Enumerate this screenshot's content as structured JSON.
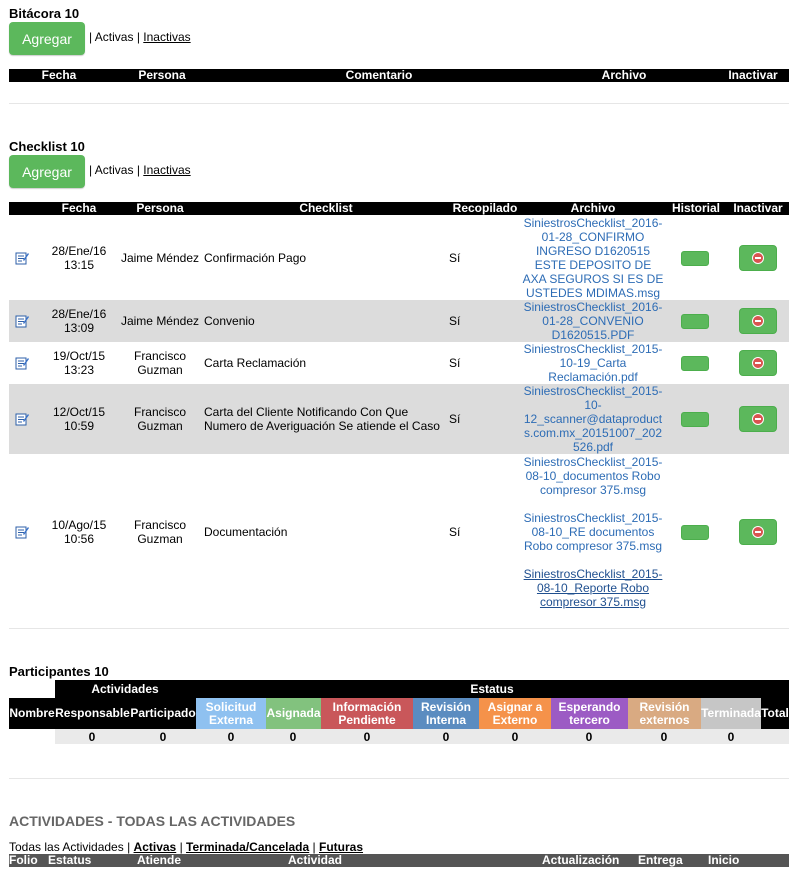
{
  "bitacora": {
    "title": "Bitácora 10",
    "add_label": "Agregar",
    "filter_sep1": "| ",
    "filter_active": "Activas",
    "filter_sep2": " | ",
    "filter_inactive": "Inactivas",
    "columns": [
      "Fecha",
      "Persona",
      "Comentario",
      "Archivo",
      "Inactivar"
    ]
  },
  "checklist": {
    "title": "Checklist 10",
    "add_label": "Agregar",
    "filter_sep1": "| ",
    "filter_active": "Activas",
    "filter_sep2": " | ",
    "filter_inactive": "Inactivas",
    "columns": [
      "Fecha",
      "Persona",
      "Checklist",
      "Recopilado",
      "Archivo",
      "Historial",
      "Inactivar"
    ],
    "rows": [
      {
        "fecha": "28/Ene/16\n13:15",
        "persona": "Jaime Méndez",
        "checklist": "Confirmación Pago",
        "recopilado": "Sí",
        "archivos": [
          "SiniestrosChecklist_2016-\n01-28_CONFIRMO\nINGRESO D1620515\nESTE DEPOSITO DE\nAXA SEGUROS SI ES DE\nUSTEDES MDIMAS.msg"
        ]
      },
      {
        "fecha": "28/Ene/16\n13:09",
        "persona": "Jaime Méndez",
        "checklist": "Convenio",
        "recopilado": "Sí",
        "archivos": [
          "SiniestrosChecklist_2016-\n01-28_CONVENIO\nD1620515.PDF"
        ]
      },
      {
        "fecha": "19/Oct/15\n13:23",
        "persona": "Francisco\nGuzman",
        "checklist": "Carta Reclamación",
        "recopilado": "Sí",
        "archivos": [
          "SiniestrosChecklist_2015-\n10-19_Carta\nReclamación.pdf"
        ]
      },
      {
        "fecha": "12/Oct/15\n10:59",
        "persona": "Francisco\nGuzman",
        "checklist": "Carta del Cliente Notificando Con Que\nNumero de Averiguación Se atiende el Caso",
        "recopilado": "Sí",
        "archivos": [
          "SiniestrosChecklist_2015-\n10-\n12_scanner@dataproduct\ns.com.mx_20151007_202\n526.pdf"
        ]
      },
      {
        "fecha": "10/Ago/15\n10:56",
        "persona": "Francisco\nGuzman",
        "checklist": "Documentación",
        "recopilado": "Sí",
        "archivos": [
          "SiniestrosChecklist_2015-\n08-10_documentos Robo\ncompresor 375.msg",
          "SiniestrosChecklist_2015-\n08-10_RE documentos\nRobo compresor 375.msg",
          "SiniestrosChecklist_2015-\n08-10_Reporte Robo\ncompresor 375.msg"
        ]
      }
    ]
  },
  "participantes": {
    "title": "Participantes 10",
    "group_actividades": "Actividades",
    "group_estatus": "Estatus",
    "columns": [
      {
        "label": "Nombre",
        "color": "#000000"
      },
      {
        "label": "Responsable",
        "color": "#000000"
      },
      {
        "label": "Participado",
        "color": "#000000"
      },
      {
        "label": "Solicitud\nExterna",
        "color": "#8fc1f0"
      },
      {
        "label": "Asignada",
        "color": "#82c27e"
      },
      {
        "label": "Información\nPendiente",
        "color": "#c9575a"
      },
      {
        "label": "Revisión\nInterna",
        "color": "#5b8cc0"
      },
      {
        "label": "Asignar a\nExterno",
        "color": "#f5924a"
      },
      {
        "label": "Esperando\ntercero",
        "color": "#9c5bc4"
      },
      {
        "label": "Revisión\nexternos",
        "color": "#d9aa82"
      },
      {
        "label": "Terminada",
        "color": "#c6c6c6"
      },
      {
        "label": "Total",
        "color": "#000000"
      }
    ],
    "values": [
      "0",
      "0",
      "0",
      "0",
      "0",
      "0",
      "0",
      "0",
      "0",
      "0"
    ]
  },
  "actividades": {
    "title": "ACTIVIDADES - TODAS LAS ACTIVIDADES",
    "filter_all": "Todas las Actividades",
    "sep": " | ",
    "filter_active": "Activas",
    "filter_done": "Terminada/Cancelada",
    "filter_future": "Futuras",
    "columns": [
      "Folio",
      "Estatus",
      "Atiende",
      "Actividad",
      "Actualización",
      "Entrega",
      "Inicio"
    ]
  }
}
